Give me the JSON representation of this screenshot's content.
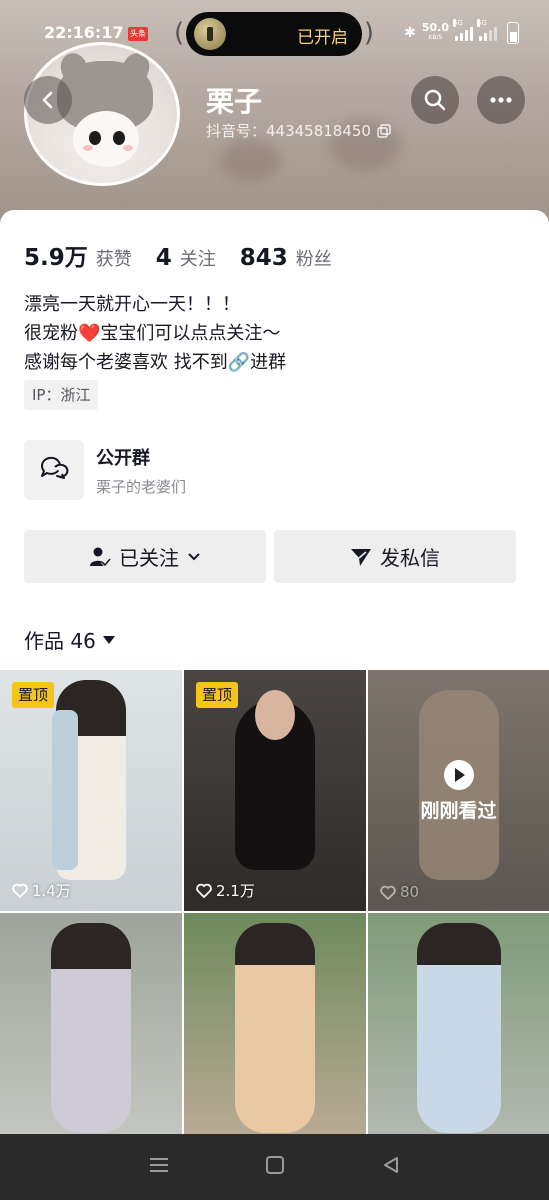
{
  "status_bar": {
    "time": "22:16:17",
    "app_badge": "头条",
    "island_text": "已开启",
    "net_speed": "50.0",
    "net_speed_unit": "KB/S",
    "signal1_tag": "5G",
    "signal2_tag": "5G"
  },
  "profile": {
    "nickname": "栗子",
    "douyin_id": "抖音号：44345818450",
    "avatar_icon": "cat-avatar",
    "back_icon": "chevron-left-icon",
    "search_icon": "search-icon",
    "more_icon": "more-icon"
  },
  "stats": [
    {
      "value": "5.9万",
      "label": "获赞"
    },
    {
      "value": "4",
      "label": "关注"
    },
    {
      "value": "843",
      "label": "粉丝"
    }
  ],
  "bio": [
    "漂亮一天就开心一天！！！",
    "很宠粉❤️宝宝们可以点点关注～",
    "感谢每个老婆喜欢 找不到🔗进群"
  ],
  "ip_tag": "IP：浙江",
  "group": {
    "title": "公开群",
    "subtitle": "栗子的老婆们",
    "icon": "chat-bubbles-icon"
  },
  "actions": {
    "follow_label": "已关注",
    "message_label": "发私信"
  },
  "works": {
    "title": "作品 46",
    "items": [
      {
        "pinned": "置顶",
        "likes": "1.4万",
        "bg": "#cfd6da"
      },
      {
        "pinned": "置顶",
        "likes": "2.1万",
        "bg": "#3a3634"
      },
      {
        "watched": "刚刚看过",
        "likes": "80",
        "bg": "#6f6760"
      },
      {
        "likes": "",
        "bg": "#b9bcb5"
      },
      {
        "likes": "",
        "bg": "#c4b59f"
      },
      {
        "likes": "",
        "bg": "#aeb7ae"
      }
    ]
  },
  "colors": {
    "pin": "#f5c518",
    "heart": "#e53935",
    "nav_bar": "#2a2a2a"
  }
}
